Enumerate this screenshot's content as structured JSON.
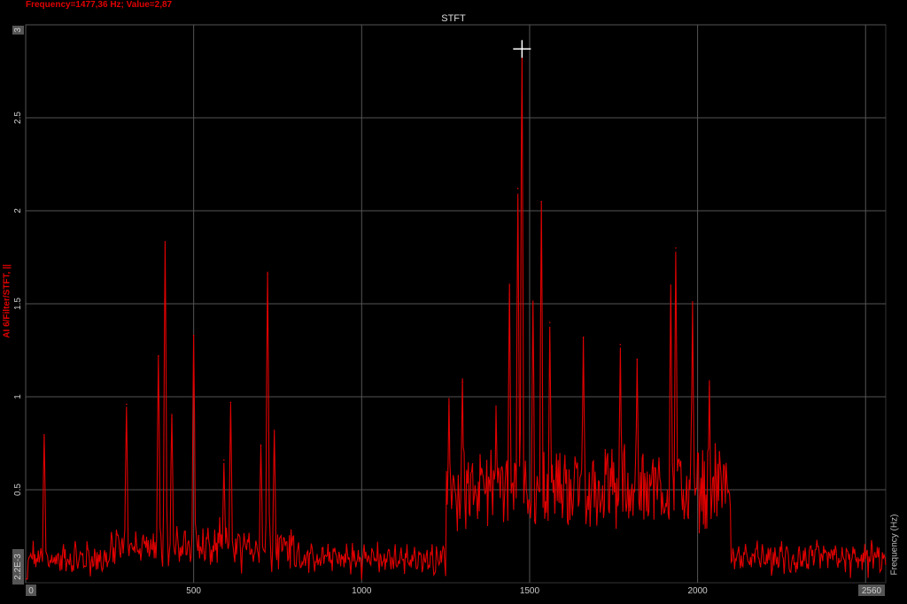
{
  "readout": "Frequency=1477,36 Hz; Value=2,87",
  "chart_data": {
    "type": "line",
    "title": "STFT",
    "xlabel": "Frequency (Hz)",
    "ylabel": "AI 6/Filter/STFT, ||",
    "xlim": [
      0,
      2560
    ],
    "ylim": [
      0,
      3
    ],
    "x_ticks": [
      "0",
      "500",
      "1000",
      "1500",
      "2000",
      "2560"
    ],
    "y_ticks": [
      "2.2E-3",
      "0.5",
      "1",
      "1.5",
      "2",
      "2.5",
      "3"
    ],
    "grid": true,
    "series_color": "#e00000",
    "cursor": {
      "x": 1477.36,
      "y": 2.87
    },
    "peaks": [
      {
        "x": 55,
        "y": 0.78
      },
      {
        "x": 300,
        "y": 0.96
      },
      {
        "x": 395,
        "y": 1.22
      },
      {
        "x": 415,
        "y": 1.8
      },
      {
        "x": 435,
        "y": 0.88
      },
      {
        "x": 500,
        "y": 1.33
      },
      {
        "x": 590,
        "y": 0.66
      },
      {
        "x": 610,
        "y": 0.97
      },
      {
        "x": 700,
        "y": 0.74
      },
      {
        "x": 720,
        "y": 1.66
      },
      {
        "x": 740,
        "y": 0.78
      },
      {
        "x": 1260,
        "y": 0.95
      },
      {
        "x": 1300,
        "y": 1.08
      },
      {
        "x": 1400,
        "y": 0.95
      },
      {
        "x": 1440,
        "y": 1.55
      },
      {
        "x": 1465,
        "y": 2.12
      },
      {
        "x": 1477,
        "y": 2.87
      },
      {
        "x": 1510,
        "y": 1.5
      },
      {
        "x": 1535,
        "y": 2.05
      },
      {
        "x": 1560,
        "y": 1.4
      },
      {
        "x": 1660,
        "y": 1.32
      },
      {
        "x": 1770,
        "y": 1.28
      },
      {
        "x": 1820,
        "y": 1.2
      },
      {
        "x": 1920,
        "y": 1.6
      },
      {
        "x": 1935,
        "y": 1.8
      },
      {
        "x": 1985,
        "y": 1.51
      },
      {
        "x": 2035,
        "y": 1.05
      },
      {
        "x": 2065,
        "y": 0.7
      }
    ]
  }
}
